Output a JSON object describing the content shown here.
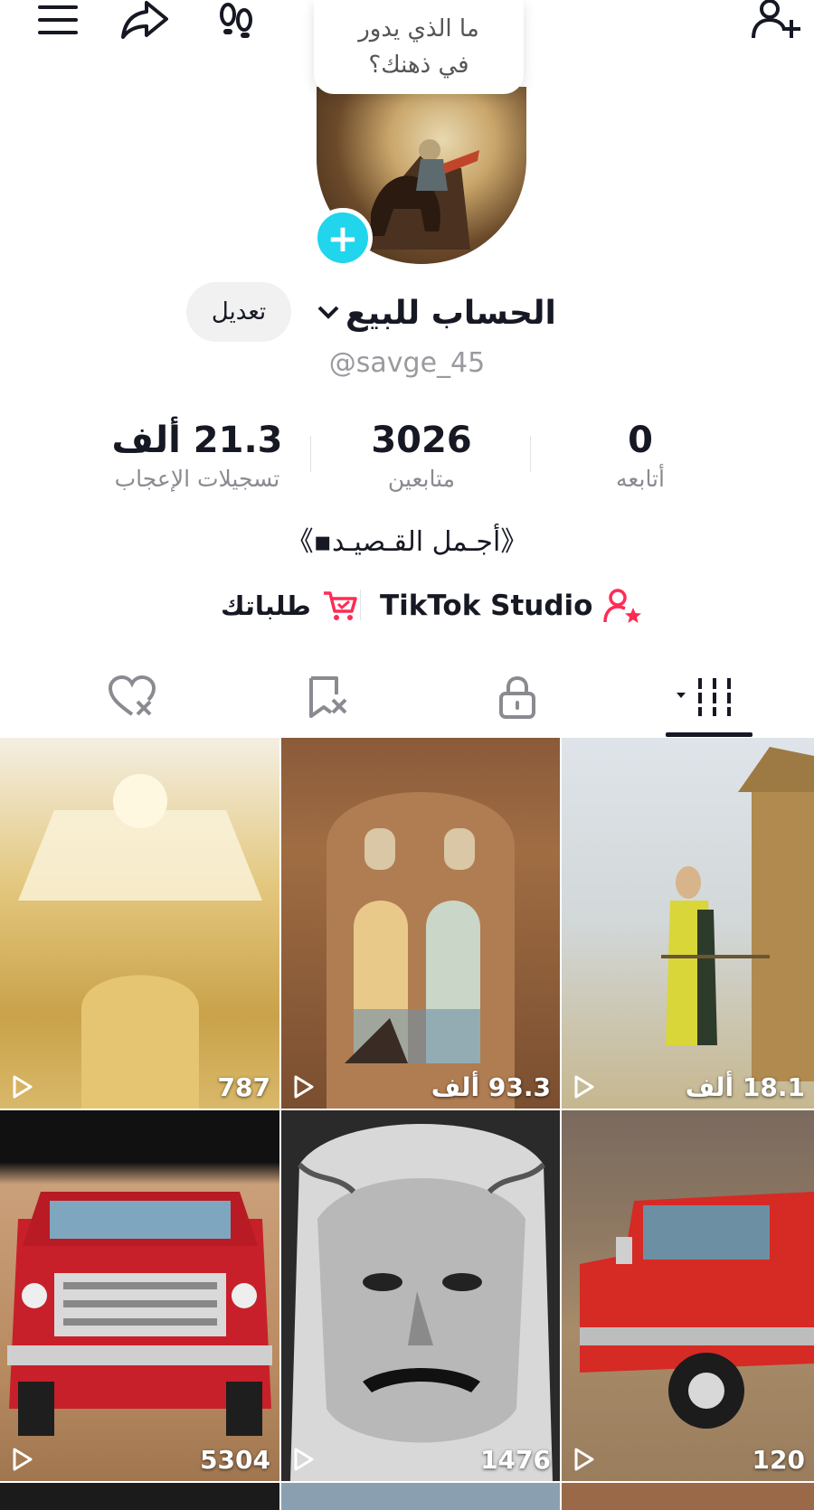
{
  "header": {
    "thought_bubble": "ما الذي يدور في ذهنك؟",
    "icons": [
      "menu-icon",
      "share-icon",
      "footprints-icon",
      "add-friend-icon"
    ]
  },
  "profile": {
    "display_name": "الحساب للبيع",
    "username": "@savge_45",
    "edit_label": "تعديل",
    "bio": "《أجـمل القـصيـد▪︎》"
  },
  "stats": {
    "following": {
      "value": "0",
      "label": "أتابعه"
    },
    "followers": {
      "value": "3026",
      "label": "متابعين"
    },
    "likes": {
      "value": "21.3 ألف",
      "label": "تسجيلات الإعجاب"
    }
  },
  "links": {
    "studio": "TikTok Studio",
    "orders": "طلباتك"
  },
  "tabs": [
    "videos-tab",
    "private-tab",
    "favorites-tab",
    "liked-tab"
  ],
  "videos": [
    {
      "views": "787"
    },
    {
      "views": "93.3 ألف"
    },
    {
      "views": "18.1 ألف"
    },
    {
      "views": "5304"
    },
    {
      "views": "1476"
    },
    {
      "views": "120"
    }
  ],
  "colors": {
    "accent": "#fe2c55",
    "plus": "#20d5ec",
    "text": "#161823",
    "muted": "#8a8b91"
  }
}
